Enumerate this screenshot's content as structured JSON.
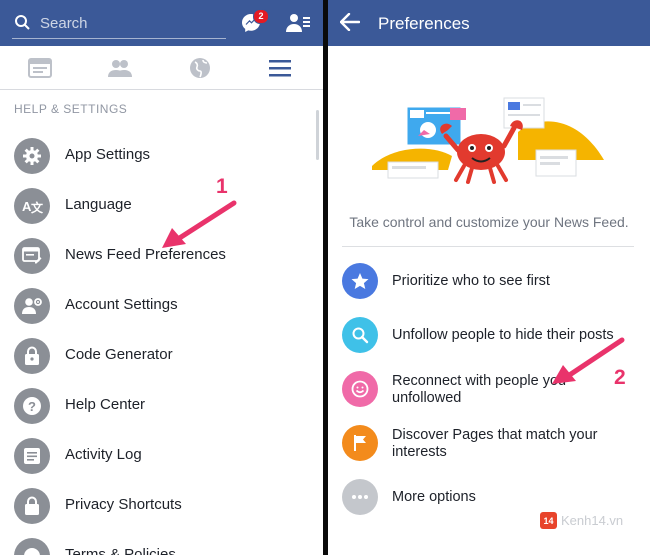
{
  "left": {
    "search": {
      "placeholder": "Search"
    },
    "messenger_badge": "2",
    "section_title": "HELP & SETTINGS",
    "menu": [
      {
        "label": "App Settings",
        "icon": "gear-icon"
      },
      {
        "label": "Language",
        "icon": "translate-icon"
      },
      {
        "label": "News Feed Preferences",
        "icon": "news-feed-icon"
      },
      {
        "label": "Account Settings",
        "icon": "user-gear-icon"
      },
      {
        "label": "Code Generator",
        "icon": "lock-icon"
      },
      {
        "label": "Help Center",
        "icon": "help-icon"
      },
      {
        "label": "Activity Log",
        "icon": "list-icon"
      },
      {
        "label": "Privacy Shortcuts",
        "icon": "lock-icon"
      },
      {
        "label": "Terms & Policies",
        "icon": "info-icon"
      }
    ],
    "annotation": "1"
  },
  "right": {
    "title": "Preferences",
    "description": "Take control and customize your News Feed.",
    "options": [
      {
        "label": "Prioritize who to see first",
        "icon": "star-icon",
        "color": "#4a79e0"
      },
      {
        "label": "Unfollow people to hide their posts",
        "icon": "search-icon",
        "color": "#3fc1e8"
      },
      {
        "label": "Reconnect with people you unfollowed",
        "icon": "smile-icon",
        "color": "#f06aa8"
      },
      {
        "label": "Discover Pages that match your interests",
        "icon": "flag-icon",
        "color": "#f38b1c"
      },
      {
        "label": "More options",
        "icon": "more-icon",
        "color": "#c4c7cc"
      }
    ],
    "annotation": "2"
  },
  "watermark": {
    "badge": "14",
    "text": "Kenh14.vn"
  },
  "colors": {
    "brand": "#3b5998",
    "annotation": "#e9336b"
  }
}
